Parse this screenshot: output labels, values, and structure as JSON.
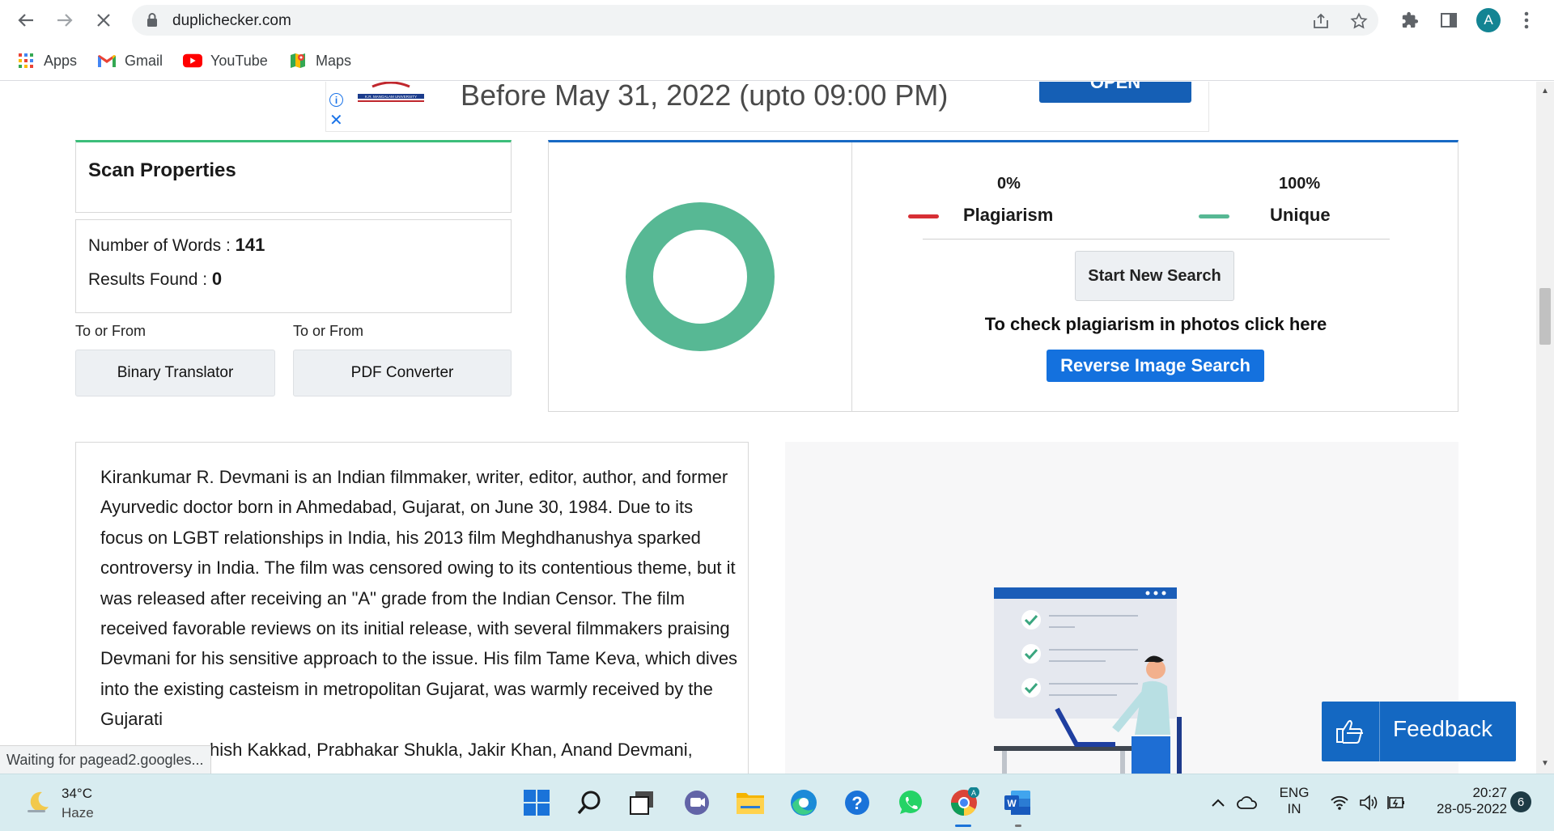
{
  "browser": {
    "url": "duplichecker.com",
    "avatar_letter": "A",
    "bookmarks": [
      {
        "label": "Apps",
        "icon": "apps-grid-icon"
      },
      {
        "label": "Gmail",
        "icon": "gmail-icon"
      },
      {
        "label": "YouTube",
        "icon": "youtube-icon"
      },
      {
        "label": "Maps",
        "icon": "maps-icon"
      }
    ],
    "status_text": "Waiting for pagead2.googles..."
  },
  "ad": {
    "logo_text": "K.R. MANGALAM UNIVERSITY",
    "headline": "Before May 31, 2022 (upto 09:00 PM)",
    "button_label": "OPEN"
  },
  "scan": {
    "title": "Scan Properties",
    "words_label": "Number of Words : ",
    "words_value": "141",
    "results_label": "Results Found : ",
    "results_value": "0",
    "tools": [
      {
        "caption": "To or From",
        "label": "Binary Translator"
      },
      {
        "caption": "To or From",
        "label": "PDF Converter"
      }
    ]
  },
  "result": {
    "plagiarism_percent": "0%",
    "plagiarism_label": "Plagiarism",
    "unique_percent": "100%",
    "unique_label": "Unique",
    "start_button": "Start New Search",
    "photo_text": "To check plagiarism in photos click here",
    "reverse_button": "Reverse Image Search",
    "colors": {
      "plagiarism": "#d72f35",
      "unique": "#57b894"
    }
  },
  "content": {
    "text": "Kirankumar R. Devmani is an Indian filmmaker, writer, editor, author, and former Ayurvedic doctor   born in Ahmedabad, Gujarat, on June 30, 1984. Due to its focus on LGBT relationships in India, his 2013 film Meghdhanushya sparked controversy in India. The film was censored owing to its contentious theme, but it was released after receiving an \"A\" grade from the Indian Censor. The film received favorable reviews on its initial release, with several filmmakers praising Devmani for his sensitive approach to the issue. His film Tame Keva, which dives into the existing casteism in metropolitan Gujarat, was warmly received by the Gujarati",
    "partial_line": "hish Kakkad, Prabhakar Shukla, Jakir Khan, Anand Devmani,"
  },
  "feedback_label": "Feedback",
  "taskbar": {
    "temperature": "34°C",
    "weather": "Haze",
    "lang_top": "ENG",
    "lang_bottom": "IN",
    "time": "20:27",
    "date": "28-05-2022",
    "notifications": "6"
  }
}
